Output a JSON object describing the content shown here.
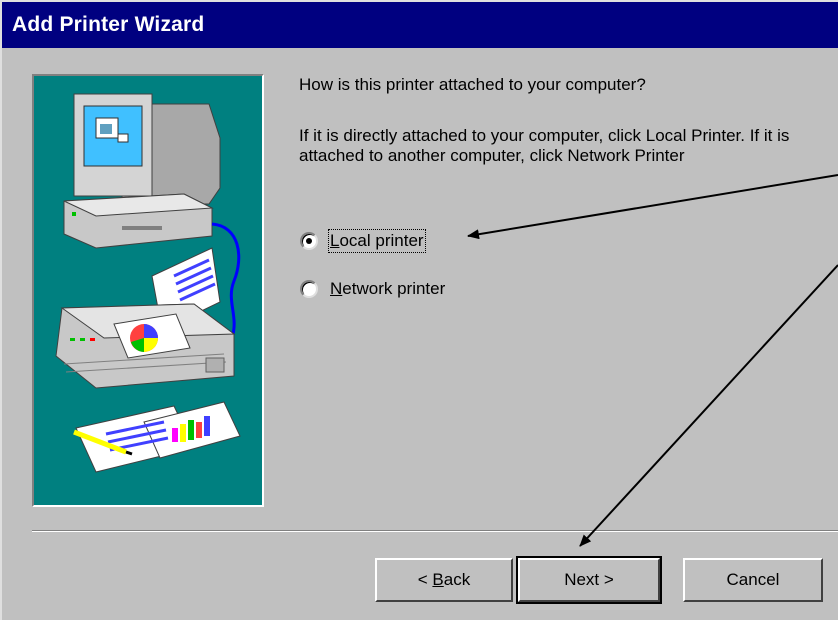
{
  "window": {
    "title": "Add Printer Wizard"
  },
  "content": {
    "question": "How is this printer attached to your computer?",
    "instructions": "If it is directly attached to your computer, click Local Printer. If it is attached to another computer, click Network Printer"
  },
  "options": [
    {
      "label": "Local printer",
      "mnemonic": "L",
      "rest": "ocal printer",
      "selected": true
    },
    {
      "label": "Network printer",
      "mnemonic": "N",
      "rest": "etwork printer",
      "selected": false
    }
  ],
  "buttons": {
    "back": {
      "prefix": "< ",
      "mnemonic": "B",
      "rest": "ack"
    },
    "next": "Next >",
    "cancel": "Cancel"
  },
  "illustration": {
    "icons": [
      "computer-icon",
      "printer-icon",
      "documents-icon"
    ],
    "background_color": "#008080"
  },
  "colors": {
    "titlebar": "#000080",
    "dialog": "#c0c0c0"
  }
}
